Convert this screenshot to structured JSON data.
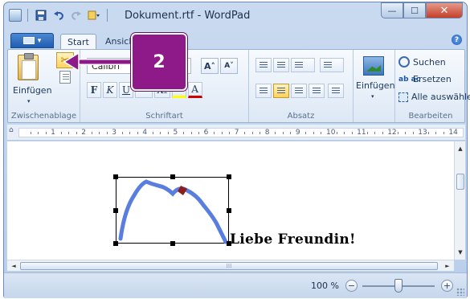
{
  "window": {
    "title": "Dokument.rtf - WordPad",
    "controls": {
      "minimize": "—",
      "maximize": "☐",
      "close": "✕"
    }
  },
  "quick_access": {
    "save_icon": "save-icon",
    "undo_icon": "undo-icon",
    "redo_icon": "redo-icon",
    "customize_icon": "customize-icon"
  },
  "tabs": [
    {
      "label": "Start"
    },
    {
      "label": "Ansicht"
    }
  ],
  "app_menu": {
    "arrow": "▾"
  },
  "help": {
    "label": "?"
  },
  "clipboard": {
    "paste_label": "Einfügen",
    "group_label": "Zwischenablage",
    "cut_glyph": "✂",
    "paste_arrow": "▾"
  },
  "font": {
    "family_value": "Calibri",
    "grow_label": "A˄",
    "shrink_label": "A˅",
    "bold_label": "F",
    "italic_label": "K",
    "underline_label": "U",
    "strike_label": "abc",
    "subscript_label": "X₂",
    "superscript_label": "X²",
    "highlight_label": "✎",
    "color_label": "A",
    "group_label": "Schriftart"
  },
  "paragraph": {
    "group_label": "Absatz"
  },
  "insert": {
    "label": "Einfügen",
    "arrow": "▾"
  },
  "editing": {
    "find_label": "Suchen",
    "replace_label": "Ersetzen",
    "replace_icon_text": "ab ac",
    "select_all_label": "Alle auswählen",
    "group_label": "Bearbeiten"
  },
  "ruler": {
    "marker": "⌂",
    "numbers": [
      "1",
      "2",
      "3",
      "4",
      "5",
      "6",
      "7",
      "8",
      "9",
      "10",
      "11",
      "12",
      "13",
      "14"
    ]
  },
  "document": {
    "text": "Liebe Freundin!"
  },
  "scrollbars": {
    "up": "▲",
    "down": "▼",
    "left": "◄",
    "right": "►",
    "grip": "⁞⁞⁞"
  },
  "status": {
    "zoom_value": "100 %",
    "zoom_out": "−",
    "zoom_in": "+",
    "zoom_level": 1.0
  },
  "annotation": {
    "callout_label": "2"
  },
  "colors": {
    "callout": "#8e1a8a",
    "drawing_stroke": "#5a7de0",
    "accent": "#1f5db1"
  }
}
